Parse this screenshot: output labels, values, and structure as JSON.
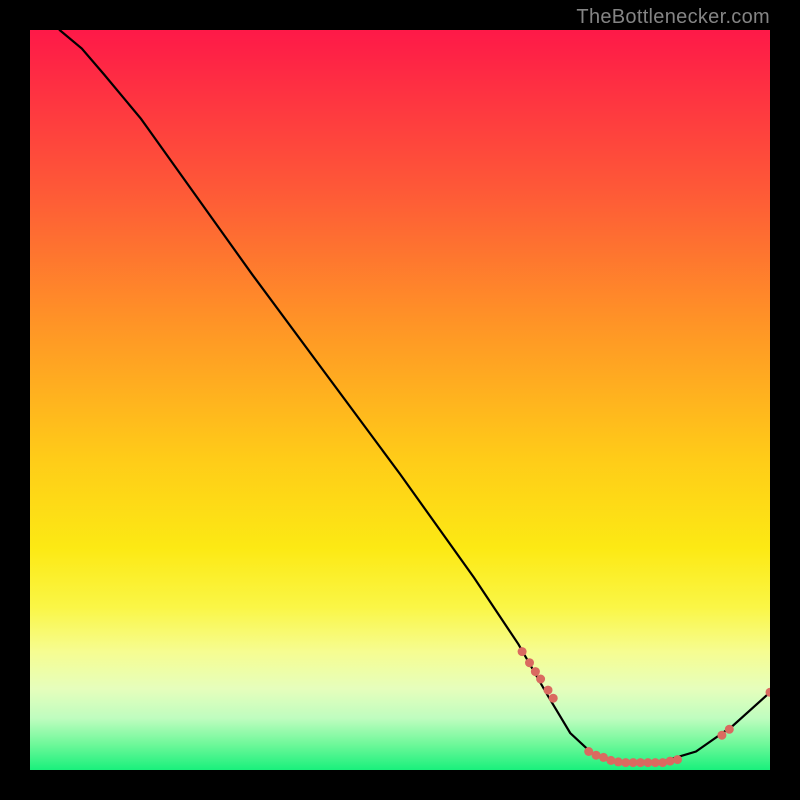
{
  "watermark": "TheBottlenecker.com",
  "colors": {
    "top_red": "#ff1a46",
    "mid_gold": "#ffd21a",
    "light_yellow": "#faff8f",
    "green": "#18f07a",
    "curve": "#000000",
    "dot": "#da6a60",
    "bg": "#000000"
  },
  "chart_data": {
    "type": "line",
    "x_range": [
      0,
      100
    ],
    "y_range": [
      0,
      100
    ],
    "title": "",
    "xlabel": "",
    "ylabel": "",
    "curve": [
      {
        "x": 4,
        "y": 100
      },
      {
        "x": 7,
        "y": 97.5
      },
      {
        "x": 10,
        "y": 94
      },
      {
        "x": 15,
        "y": 88
      },
      {
        "x": 20,
        "y": 81
      },
      {
        "x": 30,
        "y": 67
      },
      {
        "x": 40,
        "y": 53.5
      },
      {
        "x": 50,
        "y": 40
      },
      {
        "x": 60,
        "y": 26
      },
      {
        "x": 66,
        "y": 17
      },
      {
        "x": 70,
        "y": 10
      },
      {
        "x": 73,
        "y": 5
      },
      {
        "x": 76,
        "y": 2.2
      },
      {
        "x": 80,
        "y": 1
      },
      {
        "x": 85,
        "y": 1
      },
      {
        "x": 90,
        "y": 2.5
      },
      {
        "x": 95,
        "y": 6
      },
      {
        "x": 100,
        "y": 10.5
      }
    ],
    "markers": [
      {
        "x": 66.5,
        "y": 16.0
      },
      {
        "x": 67.5,
        "y": 14.5
      },
      {
        "x": 68.3,
        "y": 13.3
      },
      {
        "x": 69.0,
        "y": 12.3
      },
      {
        "x": 70.0,
        "y": 10.8
      },
      {
        "x": 70.7,
        "y": 9.7
      },
      {
        "x": 75.5,
        "y": 2.5
      },
      {
        "x": 76.5,
        "y": 2.0
      },
      {
        "x": 77.5,
        "y": 1.7
      },
      {
        "x": 78.5,
        "y": 1.3
      },
      {
        "x": 79.5,
        "y": 1.1
      },
      {
        "x": 80.5,
        "y": 1.0
      },
      {
        "x": 81.5,
        "y": 1.0
      },
      {
        "x": 82.5,
        "y": 1.0
      },
      {
        "x": 83.5,
        "y": 1.0
      },
      {
        "x": 84.5,
        "y": 1.0
      },
      {
        "x": 85.5,
        "y": 1.0
      },
      {
        "x": 86.5,
        "y": 1.2
      },
      {
        "x": 87.5,
        "y": 1.4
      },
      {
        "x": 93.5,
        "y": 4.7
      },
      {
        "x": 94.5,
        "y": 5.5
      },
      {
        "x": 100.0,
        "y": 10.5
      }
    ],
    "marker_radius": 4.5,
    "gradient_stops": [
      {
        "pos": 0.0,
        "hex": "#fe1948"
      },
      {
        "pos": 0.22,
        "hex": "#fe5a37"
      },
      {
        "pos": 0.4,
        "hex": "#ff9526"
      },
      {
        "pos": 0.58,
        "hex": "#ffcc18"
      },
      {
        "pos": 0.7,
        "hex": "#fce914"
      },
      {
        "pos": 0.78,
        "hex": "#faf646"
      },
      {
        "pos": 0.84,
        "hex": "#f6fd91"
      },
      {
        "pos": 0.89,
        "hex": "#e6febc"
      },
      {
        "pos": 0.93,
        "hex": "#bffdbf"
      },
      {
        "pos": 0.965,
        "hex": "#6ff89a"
      },
      {
        "pos": 1.0,
        "hex": "#19f07c"
      }
    ]
  }
}
